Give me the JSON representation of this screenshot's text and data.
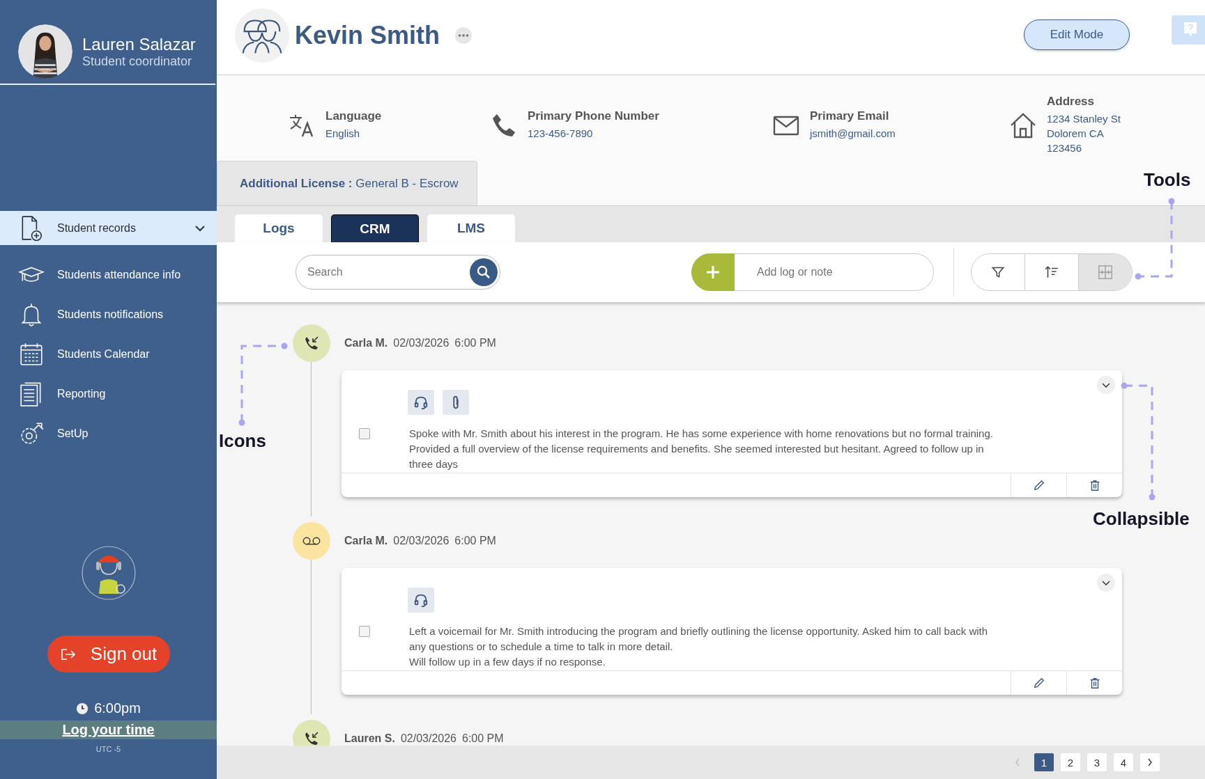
{
  "user": {
    "name": "Lauren Salazar",
    "role": "Student coordinator"
  },
  "nav": [
    {
      "kind": "records",
      "label": "Student records",
      "selected": true,
      "expandable": true
    },
    {
      "kind": "attendance",
      "label": "Students attendance info",
      "selected": false,
      "expandable": false
    },
    {
      "kind": "notifications",
      "label": "Students notifications",
      "selected": false,
      "expandable": false
    },
    {
      "kind": "calendar",
      "label": "Students Calendar",
      "selected": false,
      "expandable": false
    },
    {
      "kind": "reporting",
      "label": "Reporting",
      "selected": false,
      "expandable": false
    },
    {
      "kind": "setup",
      "label": "SetUp",
      "selected": false,
      "expandable": false
    }
  ],
  "sign_out": "Sign out",
  "clock": "6:00pm",
  "log_time": "Log your time",
  "timezone": "UTC -5",
  "profile": {
    "name": "Kevin Smith",
    "edit_button": "Edit Mode"
  },
  "contact": [
    {
      "kind": "language",
      "label": "Language",
      "values": [
        "English"
      ]
    },
    {
      "kind": "phone",
      "label": "Primary Phone Number",
      "values": [
        "123-456-7890"
      ]
    },
    {
      "kind": "email",
      "label": "Primary Email",
      "values": [
        "jsmith@gmail.com"
      ]
    },
    {
      "kind": "address",
      "label": "Address",
      "values": [
        "1234 Stanley St",
        "Dolorem  CA",
        "123456"
      ]
    }
  ],
  "license": {
    "label": "Additional License :",
    "value": "General B - Escrow"
  },
  "tabs": [
    {
      "label": "Logs",
      "selected": false
    },
    {
      "label": "CRM",
      "selected": true
    },
    {
      "label": "LMS",
      "selected": false
    }
  ],
  "search": {
    "placeholder": "Search"
  },
  "add_note": {
    "placeholder": "Add log or note"
  },
  "annotations": [
    "Tools",
    "Icons",
    "Collapsible"
  ],
  "logs": [
    {
      "kind": "call",
      "author": "Carla M.",
      "date": "02/03/2026",
      "time": "6:00 PM",
      "has_attachment": true,
      "checked": false,
      "lines": [
        "Spoke with Mr. Smith about his interest in the program. He has some experience with home renovations but no formal training.",
        "Provided a full overview of the license requirements and benefits. She seemed interested but hesitant. Agreed to follow up in",
        "three days"
      ]
    },
    {
      "kind": "voicemail",
      "author": "Carla M.",
      "date": "02/03/2026",
      "time": "6:00 PM",
      "has_attachment": false,
      "checked": false,
      "lines": [
        "Left a voicemail for Mr. Smith introducing the program and briefly outlining the license opportunity. Asked him to call back with",
        "any questions or to schedule a time to talk in more detail.",
        "Will follow up in a few days if no response."
      ]
    },
    {
      "kind": "call",
      "author": "Lauren S.",
      "date": "02/03/2026",
      "time": "6:00 PM"
    }
  ],
  "pagination": {
    "prev_disabled": true,
    "pages": [
      {
        "label": "1",
        "selected": true
      },
      {
        "label": "2",
        "selected": false
      },
      {
        "label": "3",
        "selected": false
      },
      {
        "label": "4",
        "selected": false
      }
    ]
  }
}
